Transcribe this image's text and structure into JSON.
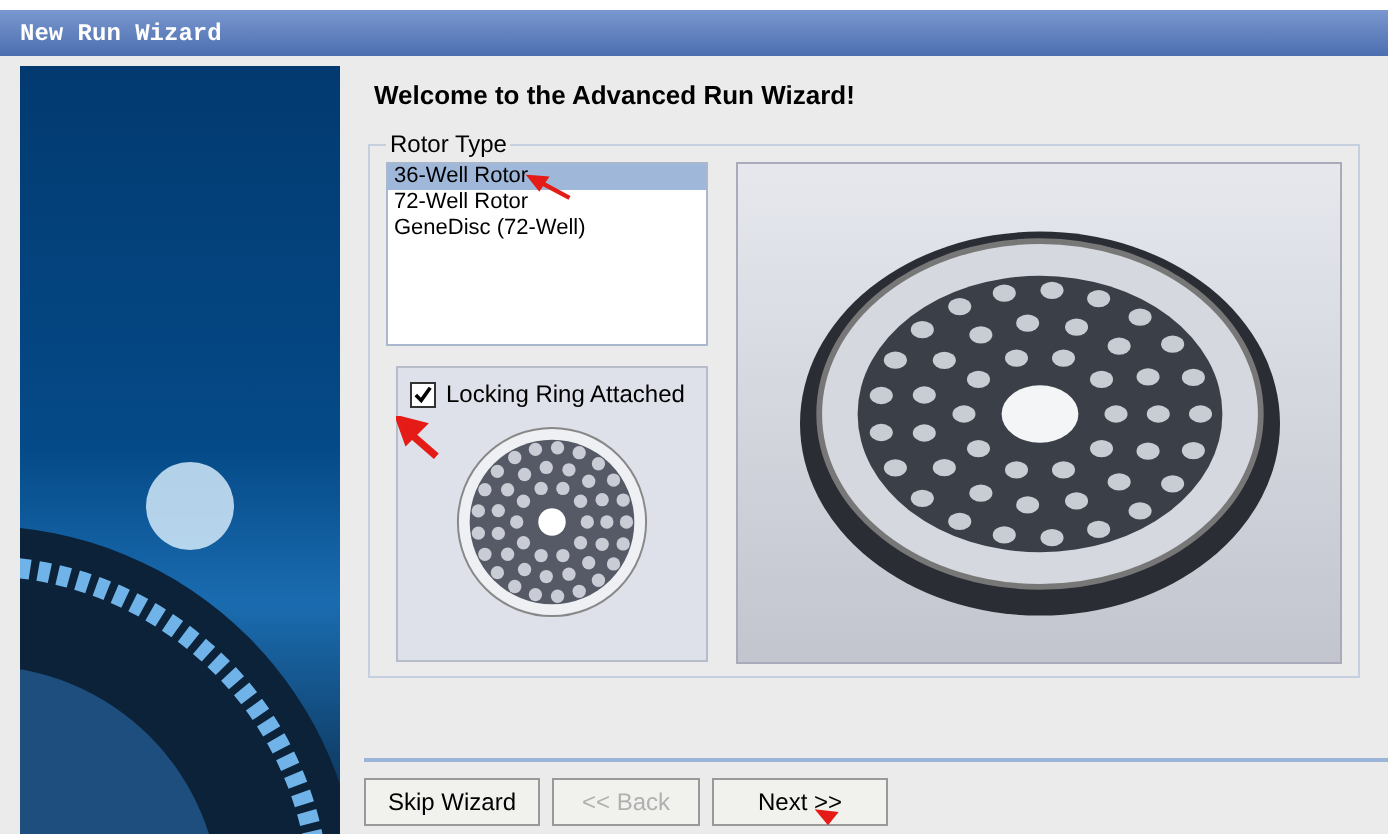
{
  "window": {
    "title": "New Run Wizard"
  },
  "heading": "Welcome to the Advanced Run Wizard!",
  "rotor_type": {
    "label": "Rotor Type",
    "items": [
      {
        "label": "36-Well Rotor",
        "selected": true
      },
      {
        "label": "72-Well Rotor",
        "selected": false
      },
      {
        "label": "GeneDisc (72-Well)",
        "selected": false
      }
    ],
    "locking_ring": {
      "label": "Locking Ring Attached",
      "checked": true
    }
  },
  "buttons": [
    {
      "label": "Skip Wizard",
      "disabled": false
    },
    {
      "label": "<< Back",
      "disabled": true
    },
    {
      "label": "Next >>",
      "disabled": false
    }
  ]
}
